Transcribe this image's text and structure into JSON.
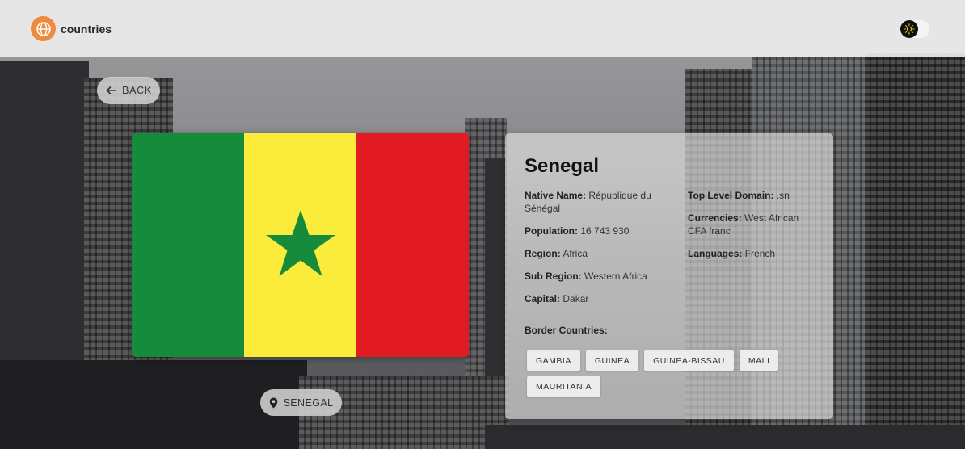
{
  "header": {
    "brand": "countries"
  },
  "back_button": {
    "label": "BACK"
  },
  "flag": {
    "colors": [
      "#178b3c",
      "#fbec3b",
      "#e21b22"
    ],
    "star_color": "#178b3c"
  },
  "name_chip": {
    "label": "SENEGAL"
  },
  "country": {
    "name": "Senegal",
    "native_name": {
      "label": "Native Name:",
      "value": "République du Sénégal"
    },
    "population": {
      "label": "Population:",
      "value": "16 743 930"
    },
    "region": {
      "label": "Region:",
      "value": "Africa"
    },
    "sub_region": {
      "label": "Sub Region:",
      "value": "Western Africa"
    },
    "capital": {
      "label": "Capital:",
      "value": "Dakar"
    },
    "top_level_domain": {
      "label": "Top Level Domain:",
      "value": ".sn"
    },
    "currencies": {
      "label": "Currencies:",
      "value": "West African CFA franc"
    },
    "languages": {
      "label": "Languages:",
      "value": "French"
    },
    "border_title": "Border Countries:",
    "borders": [
      "GAMBIA",
      "GUINEA",
      "GUINEA-BISSAU",
      "MALI",
      "MAURITANIA"
    ]
  },
  "colors": {
    "brand_accent": "#f08a3c"
  }
}
